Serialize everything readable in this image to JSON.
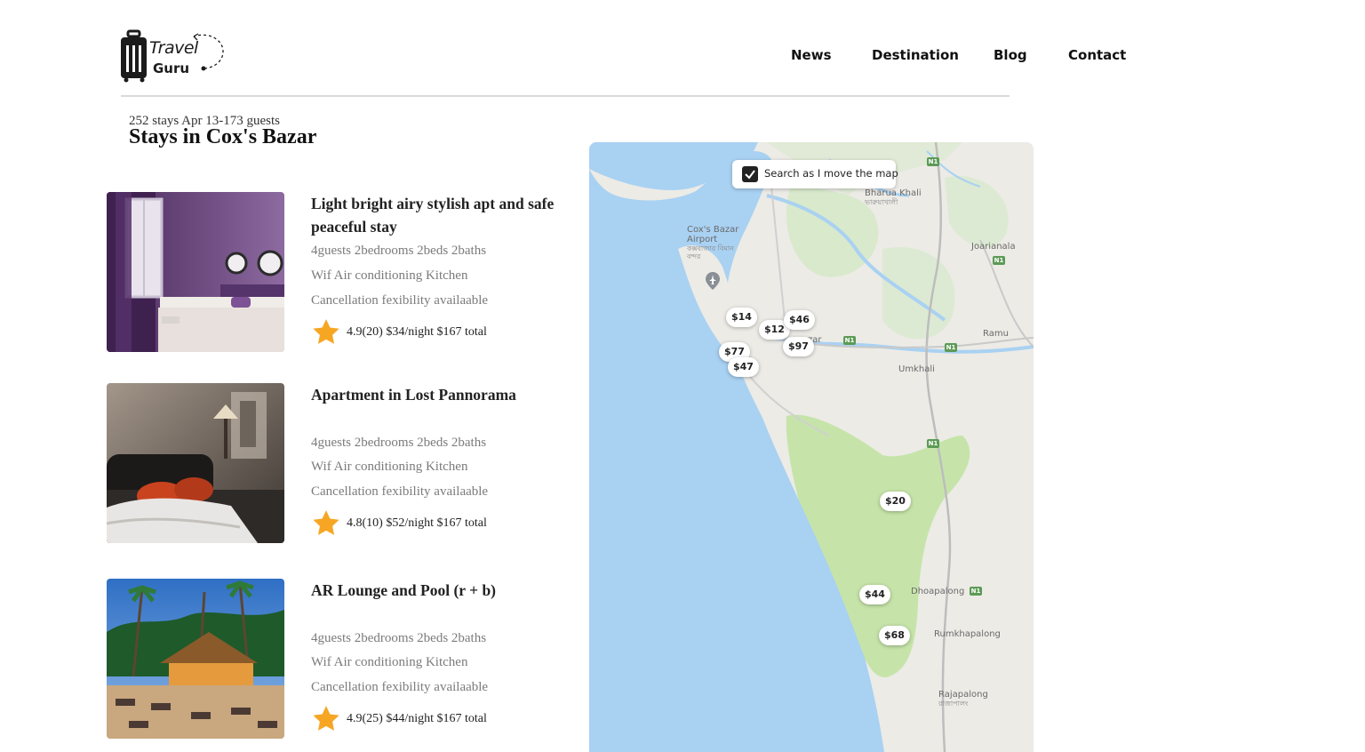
{
  "header": {
    "logo": {
      "line1": "Travel",
      "line2": "Guru"
    },
    "nav": [
      {
        "label": "News"
      },
      {
        "label": "Destination"
      },
      {
        "label": "Blog"
      },
      {
        "label": "Contact"
      }
    ]
  },
  "search": {
    "summary": "252 stays Apr 13-173 guests",
    "title": "Stays in Cox's Bazar"
  },
  "listings": [
    {
      "title": "Light bright airy stylish apt and safe peaceful stay",
      "guests": "4guests 2bedrooms 2beds 2baths",
      "amenities": "Wif Air conditioning Kitchen",
      "cancellation": "Cancellation fexibility availaable",
      "rating_text": "4.9(20) $34/night $167 total",
      "image": "purple-hotel-bedroom"
    },
    {
      "title": "Apartment in Lost Pannorama",
      "guests": "4guests 2bedrooms 2beds 2baths",
      "amenities": "Wif Air conditioning Kitchen",
      "cancellation": "Cancellation fexibility availaable",
      "rating_text": "4.8(10) $52/night $167 total",
      "image": "dark-bedroom-red-pillows"
    },
    {
      "title": "AR Lounge and Pool (r + b)",
      "guests": "4guests 2bedrooms 2beds 2baths",
      "amenities": "Wif Air conditioning Kitchen",
      "cancellation": "Cancellation fexibility availaable",
      "rating_text": "4.9(25) $44/night $167 total",
      "image": "beach-lounge-palm-trees"
    }
  ],
  "map": {
    "search_toggle_label": "Search as I move the map",
    "search_toggle_checked": true,
    "places": {
      "bharua": "Bharua Khali",
      "bharua_local": "ভারুয়াখালী",
      "airport": "Cox's Bazar Airport",
      "airport_local": "কক্সবাজার বিমান বন্দর",
      "joarianala": "Joarianala",
      "ramu": "Ramu",
      "umkhali": "Umkhali",
      "dhoapalong": "Dhoapalong",
      "rumkhapalong": "Rumkhapalong",
      "rajapalong": "Rajapalong",
      "rajapalong_local": "রাজাপালং",
      "coxs_fragment": "zar",
      "road_n1": "N1"
    },
    "prices": [
      "$14",
      "$12",
      "$46",
      "$97",
      "$77",
      "$47",
      "$20",
      "$44",
      "$68"
    ]
  },
  "colors": {
    "water": "#a9d1f2",
    "land": "#ecebe6",
    "park": "#c6e4a9",
    "star": "#f6a623"
  }
}
